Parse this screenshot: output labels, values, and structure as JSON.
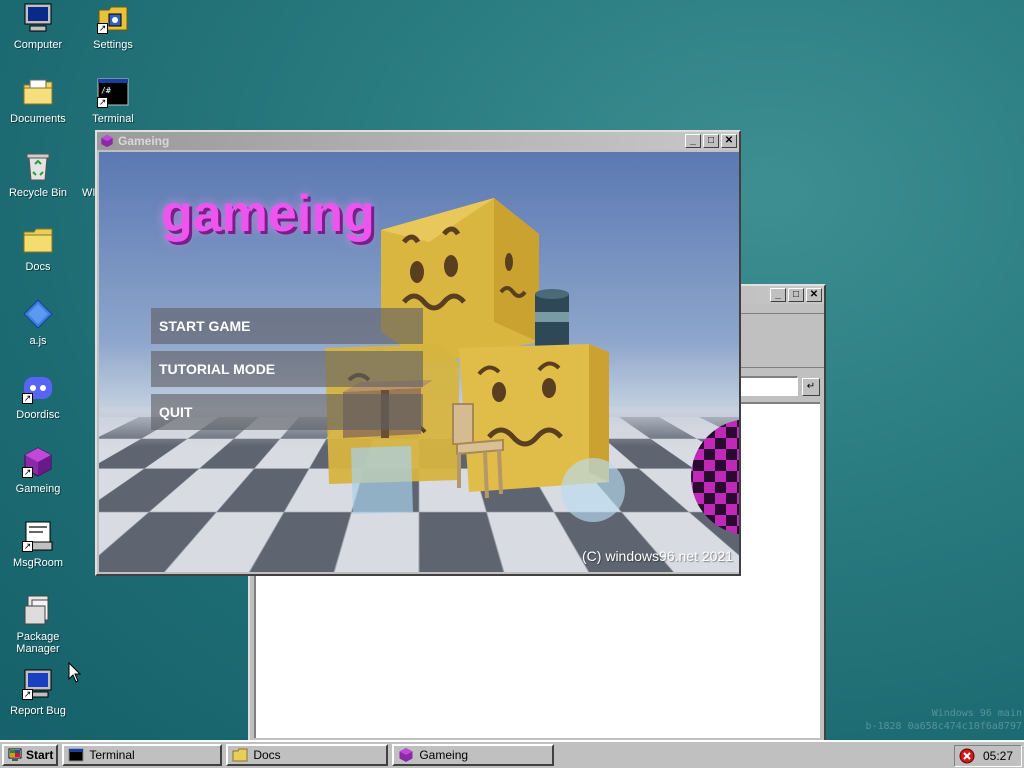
{
  "desktop": {
    "icons": [
      {
        "label": "Computer",
        "icon": "computer-icon"
      },
      {
        "label": "Settings",
        "icon": "settings-icon"
      },
      {
        "label": "Documents",
        "icon": "documents-folder-icon"
      },
      {
        "label": "Terminal",
        "icon": "terminal-icon"
      },
      {
        "label": "Recycle Bin",
        "icon": "recycle-bin-icon"
      },
      {
        "label": "Docs",
        "icon": "folder-icon"
      },
      {
        "label": "a.js",
        "icon": "js-file-icon"
      },
      {
        "label": "Doordisc",
        "icon": "doordisc-icon"
      },
      {
        "label": "Gameing",
        "icon": "gameing-icon"
      },
      {
        "label": "MsgRoom",
        "icon": "msgroom-icon"
      },
      {
        "label": "Package Manager",
        "icon": "package-manager-icon"
      },
      {
        "label": "Report Bug",
        "icon": "report-bug-icon"
      }
    ],
    "partial_label": "WI"
  },
  "game_window": {
    "title": "Gameing",
    "game_title": "gameing",
    "menu": {
      "start": "START GAME",
      "tutorial": "TUTORIAL MODE",
      "quit": "QUIT"
    },
    "copyright": "(C) windows96.net 2021"
  },
  "taskbar": {
    "start_label": "Start",
    "tasks": [
      {
        "label": "Terminal",
        "icon": "terminal-icon"
      },
      {
        "label": "Docs",
        "icon": "folder-icon"
      },
      {
        "label": "Gameing",
        "icon": "gameing-icon"
      }
    ],
    "clock": "05:27"
  },
  "watermark": {
    "line1": "Windows 96 main",
    "line2": "b-1828 0a658c474c10f6a8797"
  },
  "colors": {
    "desktop": "#2a7d81",
    "title_text": "#ee55ee",
    "menu_bg": "#5f5f64"
  }
}
